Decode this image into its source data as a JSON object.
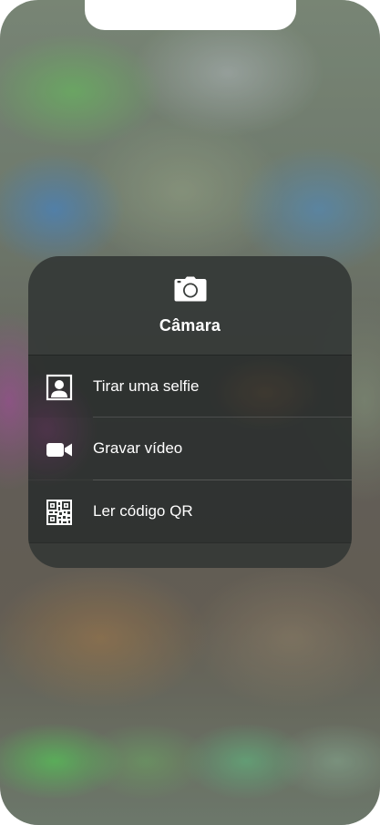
{
  "menu": {
    "title": "Câmara",
    "header_icon": "camera-icon",
    "items": [
      {
        "label": "Tirar uma selfie",
        "icon": "selfie-portrait-icon"
      },
      {
        "label": "Gravar vídeo",
        "icon": "video-camera-icon"
      },
      {
        "label": "Ler código QR",
        "icon": "qr-code-icon"
      }
    ]
  },
  "colors": {
    "menu_background": "#343836",
    "text": "#ffffff",
    "notch": "#ffffff"
  }
}
